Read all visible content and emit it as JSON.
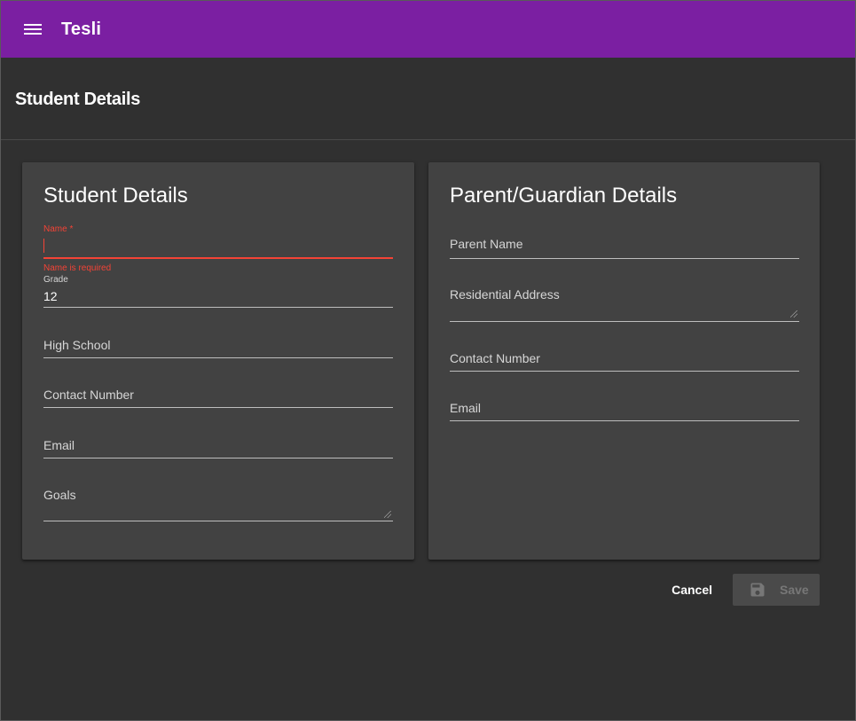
{
  "app": {
    "title": "Tesli",
    "accent": "#7b1fa2",
    "menu_icon": "menu-icon"
  },
  "page": {
    "title": "Student Details"
  },
  "student": {
    "title": "Student Details",
    "name": {
      "label": "Name *",
      "value": "",
      "error": "Name is required"
    },
    "grade": {
      "label": "Grade",
      "value": "12"
    },
    "high_school": {
      "label": "High School",
      "value": ""
    },
    "contact_number": {
      "label": "Contact Number",
      "value": ""
    },
    "email": {
      "label": "Email",
      "value": ""
    },
    "goals": {
      "label": "Goals",
      "value": ""
    }
  },
  "parent": {
    "title": "Parent/Guardian Details",
    "parent_name": {
      "label": "Parent Name",
      "value": ""
    },
    "residential_address": {
      "label": "Residential Address",
      "value": ""
    },
    "contact_number": {
      "label": "Contact Number",
      "value": ""
    },
    "email": {
      "label": "Email",
      "value": ""
    }
  },
  "actions": {
    "cancel_label": "Cancel",
    "save_label": "Save",
    "save_icon": "save-icon",
    "save_disabled": true
  }
}
